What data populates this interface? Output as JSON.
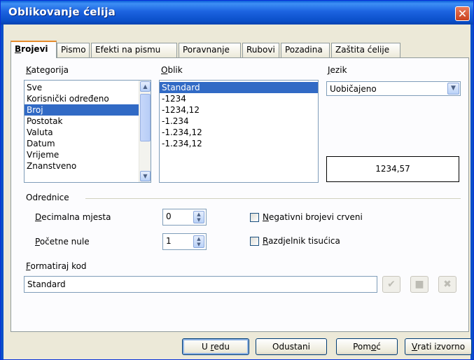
{
  "window": {
    "title": "Oblikovanje ćelija",
    "close_glyph": "✕"
  },
  "tabs": [
    {
      "pre": "",
      "key": "B",
      "post": "rojevi",
      "active": true
    },
    {
      "pre": "",
      "key": "",
      "post": "Pismo",
      "active": false
    },
    {
      "pre": "",
      "key": "",
      "post": "Efekti na pismu",
      "active": false
    },
    {
      "pre": "",
      "key": "",
      "post": "Poravnanje",
      "active": false
    },
    {
      "pre": "",
      "key": "",
      "post": "Rubovi",
      "active": false
    },
    {
      "pre": "",
      "key": "",
      "post": "Pozadina",
      "active": false
    },
    {
      "pre": "",
      "key": "",
      "post": "Zaštita ćelije",
      "active": false
    }
  ],
  "category": {
    "label_key": "K",
    "label_rest": "ategorija",
    "items": [
      "Sve",
      "Korisnički određeno",
      "Broj",
      "Postotak",
      "Valuta",
      "Datum",
      "Vrijeme",
      "Znanstveno"
    ],
    "selected": "Broj"
  },
  "format": {
    "label_key": "O",
    "label_rest": "blik",
    "items": [
      "Standard",
      "-1234",
      "-1234,12",
      "-1.234",
      "-1.234,12",
      "-1.234,12"
    ],
    "selected": "Standard"
  },
  "language": {
    "label_key": "J",
    "label_rest": "ezik",
    "value": "Uobičajeno"
  },
  "preview": {
    "value": "1234,57"
  },
  "options": {
    "section_label": "Odrednice",
    "decimal": {
      "label_key": "D",
      "label_rest": "ecimalna mjesta",
      "value": "0"
    },
    "leading": {
      "label_key": "P",
      "label_rest": "očetne nule",
      "value": "1"
    },
    "negative_red": {
      "label_key": "N",
      "label_rest": "egativni brojevi crveni",
      "checked": false
    },
    "thousands": {
      "label_key": "R",
      "label_rest": "azdjelnik tisućica",
      "checked": false
    }
  },
  "format_code": {
    "label_key": "F",
    "label_rest": "ormatiraj kod",
    "value": "Standard"
  },
  "code_buttons": {
    "accept_glyph": "✔",
    "comment_glyph": "■",
    "delete_glyph": "✖"
  },
  "buttons": {
    "ok": {
      "pre": "U ",
      "key": "r",
      "post": "edu"
    },
    "cancel": {
      "pre": "Odustani",
      "key": "",
      "post": ""
    },
    "help": {
      "pre": "Pom",
      "key": "o",
      "post": "ć"
    },
    "reset": {
      "pre": "",
      "key": "V",
      "post": "rati izvorno"
    }
  },
  "colors": {
    "title_bar": "#0a4fc9",
    "selection": "#316ac5",
    "active_tab_accent": "#e68b2c"
  }
}
